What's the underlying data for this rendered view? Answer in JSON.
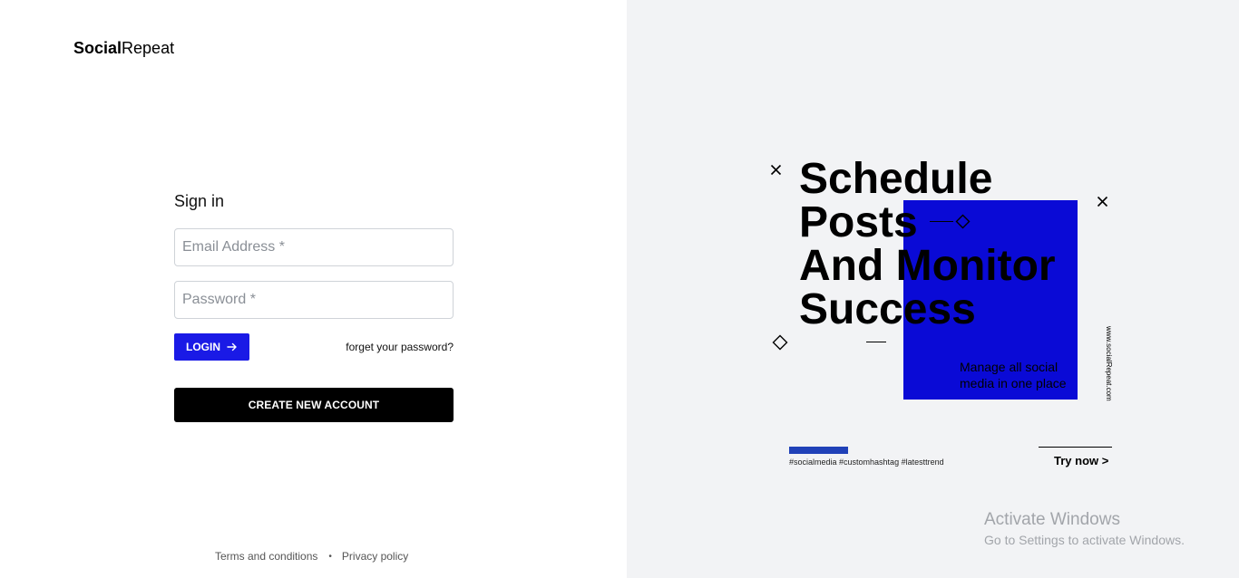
{
  "brand": {
    "name_bold": "Social",
    "name_regular": "Repeat"
  },
  "signin": {
    "title": "Sign in",
    "email_placeholder": "Email Address *",
    "email_value": "",
    "password_placeholder": "Password *",
    "password_value": "",
    "login_label": "LOGIN",
    "forgot_label": "forget your password?",
    "create_account_label": "CREATE NEW ACCOUNT"
  },
  "footer": {
    "terms_label": "Terms and conditions",
    "separator": "•",
    "privacy_label": "Privacy policy"
  },
  "promo": {
    "headline": [
      "Schedule",
      "Posts",
      "And Monitor",
      "Success"
    ],
    "tagline": "Manage all social media in one place",
    "vertical_url": "www.socialRepeat.com",
    "hashtags": "#socialmedia #customhashtag #latesttrend",
    "cta_label": "Try now >",
    "accent_blue": "#0a0ad6",
    "bar_blue": "#2041b8"
  },
  "icons": {
    "login_arrow": "arrow-right-icon",
    "decor_x": "close-icon",
    "decor_diamond": "diamond-icon"
  },
  "system_overlay": {
    "title": "Activate Windows",
    "subtitle": "Go to Settings to activate Windows."
  },
  "colors": {
    "login_button": "#1a1ae6",
    "create_button": "#000000",
    "right_panel_bg": "#f2f3f5"
  }
}
